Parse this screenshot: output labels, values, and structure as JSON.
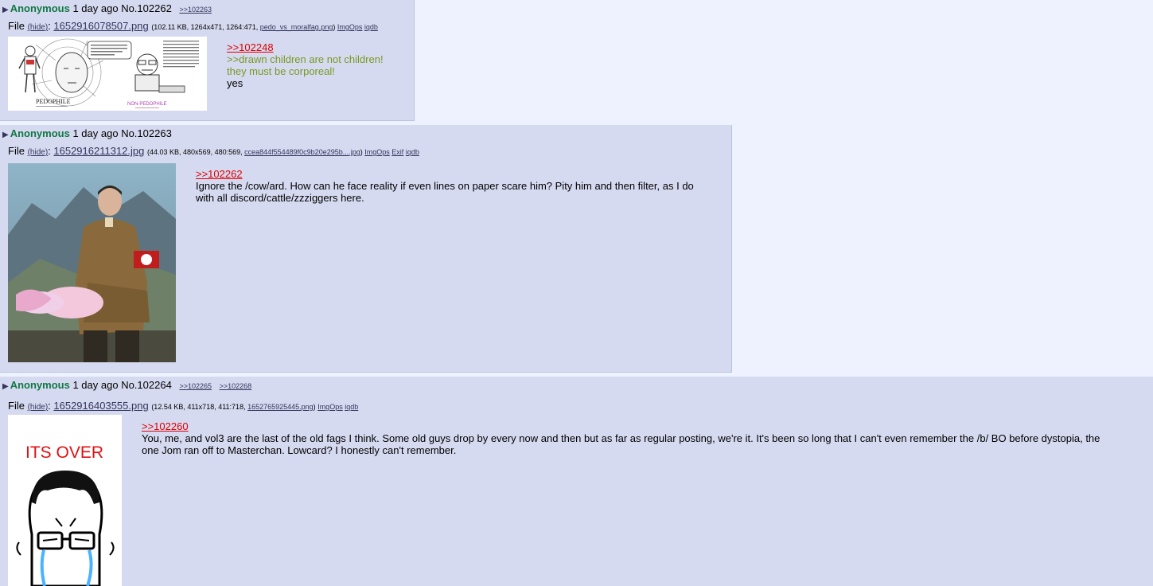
{
  "posts": [
    {
      "name": "Anonymous",
      "date": "1 day ago",
      "number": "No.102262",
      "replies": [
        ">>102263"
      ],
      "file_label": "File",
      "hide_label": "(hide)",
      "filename": "1652916078507.png",
      "info_pre": "(102.11 KB, 1264x471, 1264:471, ",
      "orig_name": "pedo_vs_moralfag.png",
      "info_post": ")",
      "tools": [
        "ImgOps",
        "iqdb"
      ],
      "image_texts": [
        "PEDOPHILE",
        "NON-PEDOPHILE"
      ],
      "quote": ">>102248",
      "greentext": [
        ">>drawn children are not children!",
        "they must be corporeal!"
      ],
      "body": [
        "yes"
      ]
    },
    {
      "name": "Anonymous",
      "date": "1 day ago",
      "number": "No.102263",
      "replies": [],
      "file_label": "File",
      "hide_label": "(hide)",
      "filename": "1652916211312.jpg",
      "info_pre": "(44.03 KB, 480x569, 480:569, ",
      "orig_name": "ccea844f554489f0c9b20e295b....jpg",
      "info_post": ")",
      "tools": [
        "ImgOps",
        "Exif",
        "iqdb"
      ],
      "quote": ">>102262",
      "greentext": [],
      "body": [
        "Ignore the /cow/ard. How can he face reality if even lines on paper scare him? Pity him and then filter, as I do",
        "with all discord/cattle/zzziggers here."
      ]
    },
    {
      "name": "Anonymous",
      "date": "1 day ago",
      "number": "No.102264",
      "replies": [
        ">>102265",
        ">>102268"
      ],
      "file_label": "File",
      "hide_label": "(hide)",
      "filename": "1652916403555.png",
      "info_pre": "(12.54 KB, 411x718, 411:718, ",
      "orig_name": "1652765925445.png",
      "info_post": ")",
      "tools": [
        "ImgOps",
        "iqdb"
      ],
      "image_texts": [
        "ITS OVER"
      ],
      "quote": ">>102260",
      "greentext": [],
      "body": [
        "You, me, and vol3 are the last of the old fags I think. Some old guys drop by every now and then but as far as regular posting, we're it. It's been so long that I can't even remember the /b/ BO before dystopia, the",
        "one Jom ran off to Masterchan. Lowcard? I honestly can't remember."
      ]
    }
  ],
  "colors": {
    "post_bg": "#d6daf0",
    "page_bg": "#eef2ff",
    "name": "#117743",
    "quotelink": "#dd0000",
    "greentext": "#789922",
    "link": "#34345c"
  },
  "icons": {
    "post_arrow": "triangle-right-icon"
  }
}
